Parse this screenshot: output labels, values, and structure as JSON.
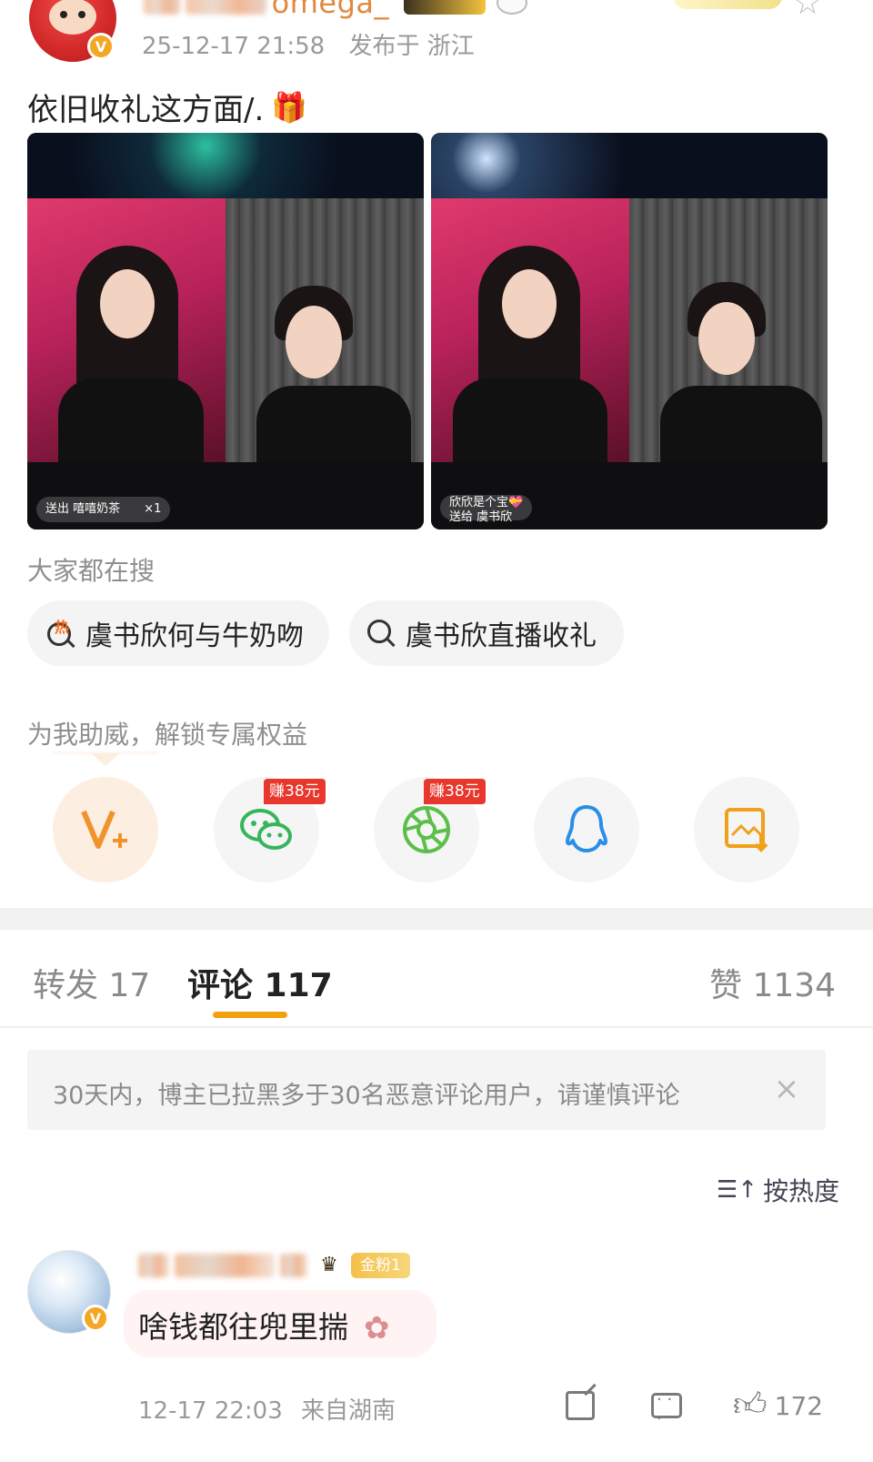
{
  "post": {
    "username_tail": "omega_",
    "time": "25-12-17 21:58",
    "location": "发布于 浙江",
    "text": "依旧收礼这方面/.",
    "media": [
      {
        "gift_text": "送出 嘻嘻奶茶",
        "gift_count": "×1"
      },
      {
        "gift_name": "欣欣是个宝💝",
        "gift_text": "送给 虞书欣"
      }
    ]
  },
  "search": {
    "label": "大家都在搜",
    "items": [
      {
        "text": "虞书欣何与牛奶吻",
        "badge": "热"
      },
      {
        "text": "虞书欣直播收礼"
      }
    ]
  },
  "support": {
    "label": "为我助威，解锁专属权益",
    "earn_badge": "赚38元"
  },
  "tabs": {
    "repost": "转发 17",
    "comment": "评论 117",
    "like": "赞 1134"
  },
  "notice": {
    "text": "30天内，博主已拉黑多于30名恶意评论用户，请谨慎评论"
  },
  "sort": {
    "label": "按热度"
  },
  "comment": {
    "fan_badge": "金粉1",
    "text": "啥钱都往兜里揣",
    "time": "12-17 22:03",
    "location": "来自湖南",
    "likes": "172"
  }
}
